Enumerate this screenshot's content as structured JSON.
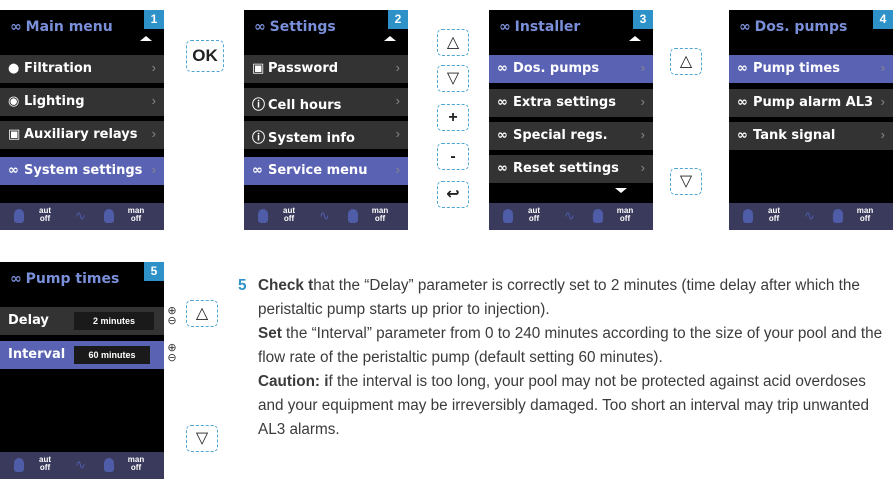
{
  "screens": [
    {
      "number": "1",
      "title": "Main menu",
      "items": [
        {
          "label": "Filtration",
          "icon": "pump-icon",
          "selected": false
        },
        {
          "label": "Lighting",
          "icon": "bulb-icon",
          "selected": false
        },
        {
          "label": "Auxiliary relays",
          "icon": "relay-icon",
          "selected": false
        },
        {
          "label": "System settings",
          "icon": "gears-icon",
          "selected": true
        }
      ]
    },
    {
      "number": "2",
      "title": "Settings",
      "items": [
        {
          "label": "Password",
          "icon": "lock-icon",
          "selected": false
        },
        {
          "label": "Cell hours",
          "icon": "info-icon",
          "selected": false
        },
        {
          "label": "System info",
          "icon": "info-icon",
          "selected": false
        },
        {
          "label": "Service menu",
          "icon": "gears-icon",
          "selected": true
        }
      ]
    },
    {
      "number": "3",
      "title": "Installer",
      "items": [
        {
          "label": "Dos. pumps",
          "icon": "gears-icon",
          "selected": true
        },
        {
          "label": "Extra settings",
          "icon": "gears-icon",
          "selected": false
        },
        {
          "label": "Special regs.",
          "icon": "gears-icon",
          "selected": false
        },
        {
          "label": "Reset settings",
          "icon": "gears-icon",
          "selected": false
        }
      ]
    },
    {
      "number": "4",
      "title": "Dos. pumps",
      "items": [
        {
          "label": "Pump times",
          "icon": "gears-icon",
          "selected": true
        },
        {
          "label": "Pump alarm AL3",
          "icon": "gears-icon",
          "selected": false
        },
        {
          "label": "Tank signal",
          "icon": "gears-icon",
          "selected": false
        }
      ]
    },
    {
      "number": "5",
      "title": "Pump times",
      "items": [
        {
          "label": "Delay",
          "value": "2 minutes",
          "selected": false
        },
        {
          "label": "Interval",
          "value": "60 minutes",
          "selected": true
        }
      ]
    }
  ],
  "footer": {
    "aut": "aut",
    "aut_state": "off",
    "man": "man",
    "man_state": "off"
  },
  "buttons": {
    "ok": "OK",
    "up": "△",
    "down": "▽",
    "plus": "+",
    "minus": "-",
    "back": "↩",
    "plus_small": "⊕",
    "minus_small": "⊖"
  },
  "instruction": {
    "step": "5",
    "p1_bold": "Check t",
    "p1_rest": "hat the “Delay” parameter is correctly set to 2 minutes (time delay after which the peristaltic pump starts up prior to injection).",
    "p2_bold": "Set",
    "p2_rest": " the “Interval” parameter from 0 to 240 minutes according to the size of your pool and the flow rate of the peristaltic pump (default setting 60 minutes).",
    "p3_bold": "Caution: i",
    "p3_rest": "f the interval is too long, your pool may not be protected against acid overdoses and your equipment may be irreversibly damaged. Too short an interval may trip unwanted AL3 alarms."
  },
  "colors": {
    "accent": "#2e92c9",
    "selection": "#5a62b4",
    "row": "#333333",
    "title": "#7a8fd9"
  }
}
